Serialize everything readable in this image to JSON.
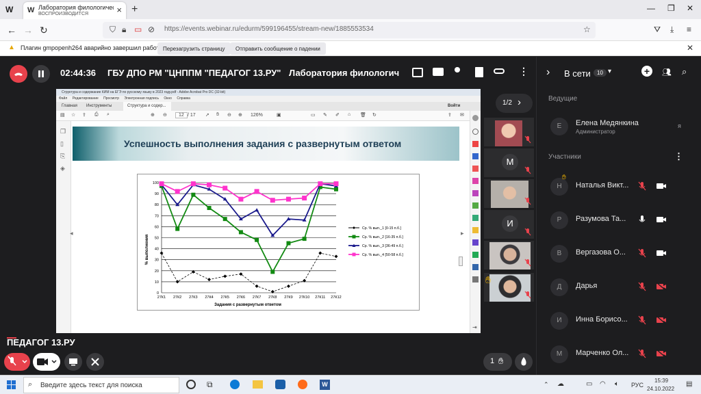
{
  "browser": {
    "tab_title": "Лаборатория филологическо",
    "tab_status": "ВОСПРОИЗВОДИТСЯ",
    "url": "https://events.webinar.ru/edurm/599196455/stream-new/1885553534",
    "new_tab": "+",
    "close_tab": "×"
  },
  "notification": {
    "message": "Плагин gmpopenh264 аварийно завершил работу.",
    "restart_label": "Перезагрузить страницу",
    "report_label": "Отправить сообщение о падении"
  },
  "webinar": {
    "timer": "02:44:36",
    "org_name": "ГБУ ДПО РМ \"ЦНППМ \"ПЕДАГОГ 13.РУ\"",
    "event_title": "Лаборатория филологич",
    "page_counter": "1/2",
    "speaker_overlay": "ПЕДАГОГ 13.РУ",
    "raise_hand_count": "1"
  },
  "acrobat": {
    "title": "Структура и содержание КИМ на ЕГЭ по русскому языку в 2023 году.pdf - Adobe Acrobat Pro DC (32-bit)",
    "menu": [
      "Файл",
      "Редактирование",
      "Просмотр",
      "Электронная подпись",
      "Окно",
      "Справка"
    ],
    "tab_home": "Главная",
    "tab_tools": "Инструменты",
    "tab_doc": "Структура и содер...",
    "signin": "Войти",
    "page_num": "12",
    "page_total": "/ 17",
    "zoom": "126%"
  },
  "slide": {
    "title": "Успешность выполнения задания с развернутым ответом"
  },
  "chart_data": {
    "type": "line",
    "xlabel": "Задания с развернутым ответом",
    "ylabel": "% выполнения",
    "ylim": [
      0,
      100
    ],
    "yticks": [
      "0",
      "10",
      "20",
      "30",
      "40",
      "50",
      "60",
      "70",
      "80",
      "90",
      "100"
    ],
    "categories": [
      "27К1",
      "27К2",
      "27К3",
      "27К4",
      "27К5",
      "27К6",
      "27К7",
      "27К8",
      "27К9",
      "27К10",
      "27К11",
      "27К12"
    ],
    "series": [
      {
        "name": "Ср. % вып._1 [0-15 п.б.]",
        "color": "#000000",
        "values": [
          36,
          10,
          19,
          12,
          15,
          17,
          6,
          1,
          6,
          11,
          36,
          33
        ]
      },
      {
        "name": "Ср. % вып._2 [16-35 п.б.]",
        "color": "#128a12",
        "values": [
          97,
          58,
          89,
          77,
          67,
          55,
          48,
          19,
          45,
          49,
          96,
          94
        ]
      },
      {
        "name": "Ср. % вып._3 [36-49 п.б.]",
        "color": "#1a1a8c",
        "values": [
          98,
          80,
          98,
          94,
          85,
          67,
          75,
          52,
          67,
          66,
          99,
          97
        ]
      },
      {
        "name": "Ср. % вып._4 [50-58 п.б.]",
        "color": "#ff33cc",
        "values": [
          99,
          92,
          99,
          98,
          95,
          85,
          92,
          84,
          85,
          86,
          99,
          99
        ]
      }
    ],
    "legend": "right"
  },
  "sidebar": {
    "online_label": "В сети",
    "online_count": "10",
    "hosts_label": "Ведущие",
    "host": {
      "initial": "Е",
      "name": "Елена Медянкина",
      "role": "Администратор",
      "me": "я"
    },
    "participants_label": "Участники",
    "participants": [
      {
        "initial": "Н",
        "name": "Наталья Викт...",
        "mic": "off",
        "cam": "on"
      },
      {
        "initial": "Р",
        "name": "Разумова Та...",
        "mic": "on",
        "cam": "on"
      },
      {
        "initial": "В",
        "name": "Вергазова О...",
        "mic": "off",
        "cam": "on"
      },
      {
        "initial": "Д",
        "name": "Дарья",
        "mic": "off",
        "cam": "off"
      },
      {
        "initial": "И",
        "name": "Инна Борисо...",
        "mic": "off",
        "cam": "off"
      },
      {
        "initial": "М",
        "name": "Марченко Ол...",
        "mic": "off",
        "cam": "off"
      }
    ]
  },
  "video_thumbs": [
    {
      "initial": ""
    },
    {
      "initial": "М"
    },
    {
      "initial": ""
    },
    {
      "initial": "И"
    },
    {
      "initial": ""
    },
    {
      "initial": ""
    }
  ],
  "taskbar": {
    "search_placeholder": "Введите здесь текст для поиска",
    "lang": "РУС",
    "time": "15:39",
    "date": "24.10.2022"
  },
  "colors": {
    "end_call_red": "#e8424c",
    "app_bg": "#1d1d1f",
    "accent_green": "#128a12"
  }
}
